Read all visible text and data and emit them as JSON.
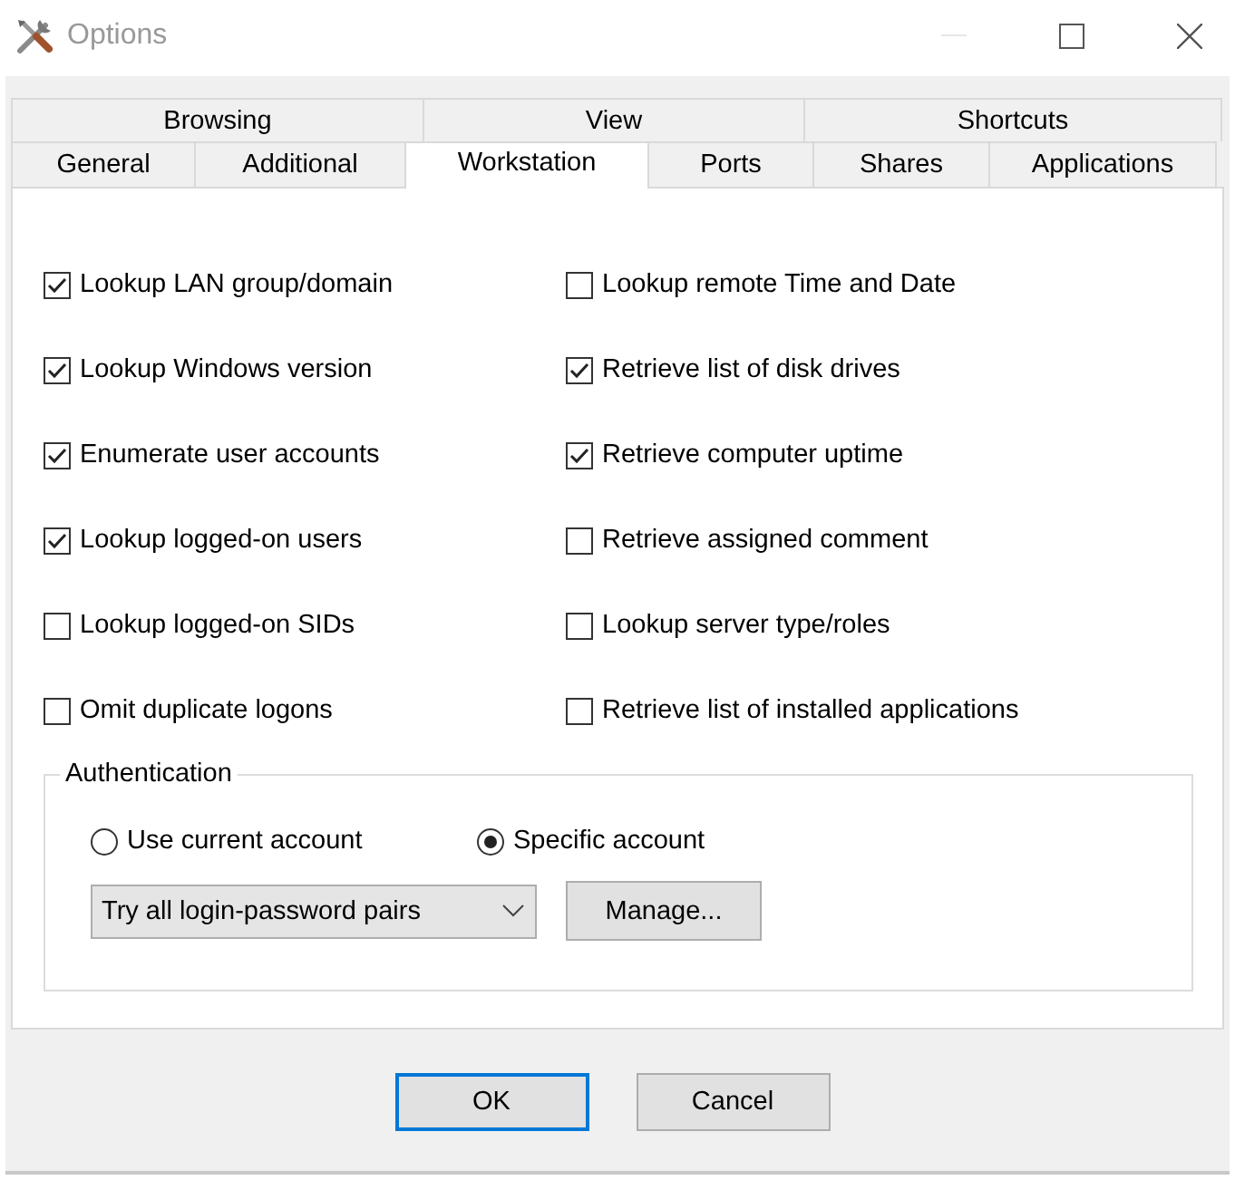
{
  "window": {
    "title": "Options"
  },
  "tab_rows": [
    [
      {
        "label": "Browsing",
        "selected": false
      },
      {
        "label": "View",
        "selected": false
      },
      {
        "label": "Shortcuts",
        "selected": false
      }
    ],
    [
      {
        "label": "General",
        "selected": false
      },
      {
        "label": "Additional",
        "selected": false
      },
      {
        "label": "Workstation",
        "selected": true
      },
      {
        "label": "Ports",
        "selected": false
      },
      {
        "label": "Shares",
        "selected": false
      },
      {
        "label": "Applications",
        "selected": false
      }
    ]
  ],
  "options": [
    {
      "label": "Lookup LAN group/domain",
      "checked": true
    },
    {
      "label": "Lookup Windows version",
      "checked": true
    },
    {
      "label": "Enumerate user accounts",
      "checked": true
    },
    {
      "label": "Lookup logged-on users",
      "checked": true
    },
    {
      "label": "Lookup logged-on SIDs",
      "checked": false
    },
    {
      "label": "Omit duplicate logons",
      "checked": false
    },
    {
      "label": "Lookup remote Time and Date",
      "checked": false
    },
    {
      "label": "Retrieve list of disk drives",
      "checked": true
    },
    {
      "label": "Retrieve computer uptime",
      "checked": true
    },
    {
      "label": "Retrieve assigned comment",
      "checked": false
    },
    {
      "label": "Lookup server type/roles",
      "checked": false
    },
    {
      "label": "Retrieve list of installed applications",
      "checked": false
    }
  ],
  "authentication": {
    "title": "Authentication",
    "radios": [
      {
        "label": "Use current account",
        "selected": false
      },
      {
        "label": "Specific account",
        "selected": true
      }
    ],
    "dropdown": {
      "value": "Try all login-password pairs"
    },
    "manage_button": "Manage..."
  },
  "buttons": [
    {
      "label": "OK",
      "default": true
    },
    {
      "label": "Cancel",
      "default": false
    }
  ]
}
